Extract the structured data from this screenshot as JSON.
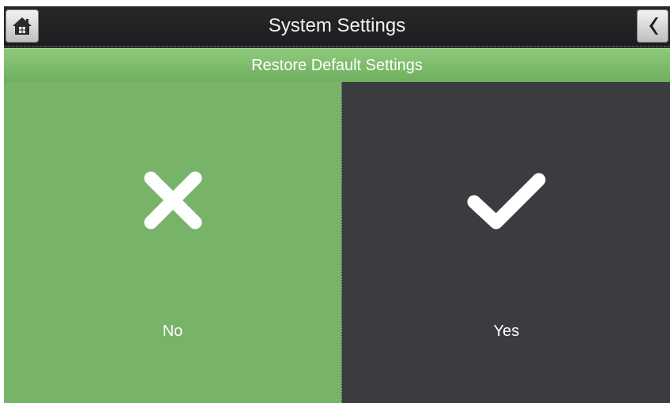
{
  "header": {
    "title": "System Settings",
    "home_icon": "home-icon",
    "back_icon": "chevron-left-icon"
  },
  "subheader": {
    "title": "Restore Default Settings"
  },
  "options": {
    "no": {
      "label": "No",
      "icon": "close-icon",
      "color": "#78b36a"
    },
    "yes": {
      "label": "Yes",
      "icon": "check-icon",
      "color": "#3a3c3f"
    }
  }
}
